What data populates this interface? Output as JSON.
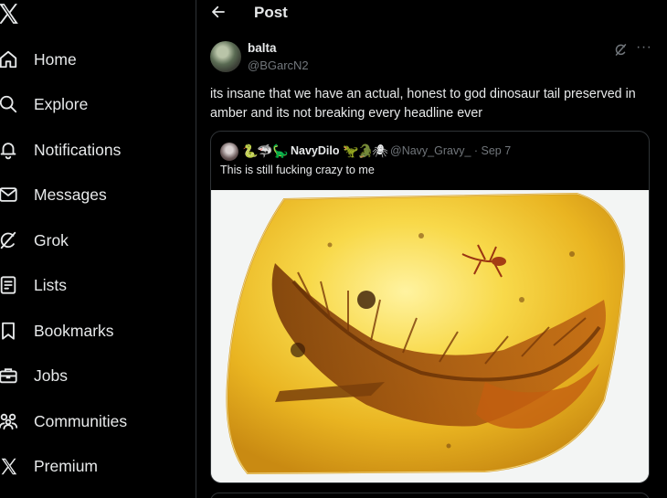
{
  "sidebar": {
    "logo_icon": "x-logo-icon",
    "items": [
      {
        "label": "Home",
        "icon": "home-icon"
      },
      {
        "label": "Explore",
        "icon": "search-icon"
      },
      {
        "label": "Notifications",
        "icon": "bell-icon"
      },
      {
        "label": "Messages",
        "icon": "envelope-icon"
      },
      {
        "label": "Grok",
        "icon": "grok-icon"
      },
      {
        "label": "Lists",
        "icon": "list-icon"
      },
      {
        "label": "Bookmarks",
        "icon": "bookmark-icon"
      },
      {
        "label": "Jobs",
        "icon": "briefcase-icon"
      },
      {
        "label": "Communities",
        "icon": "people-icon"
      },
      {
        "label": "Premium",
        "icon": "x-logo-icon"
      }
    ]
  },
  "header": {
    "title": "Post",
    "back_icon": "back-arrow-icon"
  },
  "post": {
    "author_name": "balta",
    "author_handle": "@BGarcN2",
    "text": "its insane that we have an actual, honest to god dinosaur tail preserved in amber and its not breaking every headline ever",
    "quote": {
      "display_name": "NavyDilo",
      "handle_date": "@Navy_Gravy_ · Sep 7",
      "text": "This is still fucking crazy to me",
      "emojis_before": [
        "🐍",
        "🦈",
        "🦕"
      ],
      "emojis_after": [
        "🦖",
        "🐊",
        "🕷"
      ]
    }
  },
  "colors": {
    "background": "#000000",
    "text_primary": "#e7e9ea",
    "text_secondary": "#71767b",
    "border": "#2f3336"
  }
}
